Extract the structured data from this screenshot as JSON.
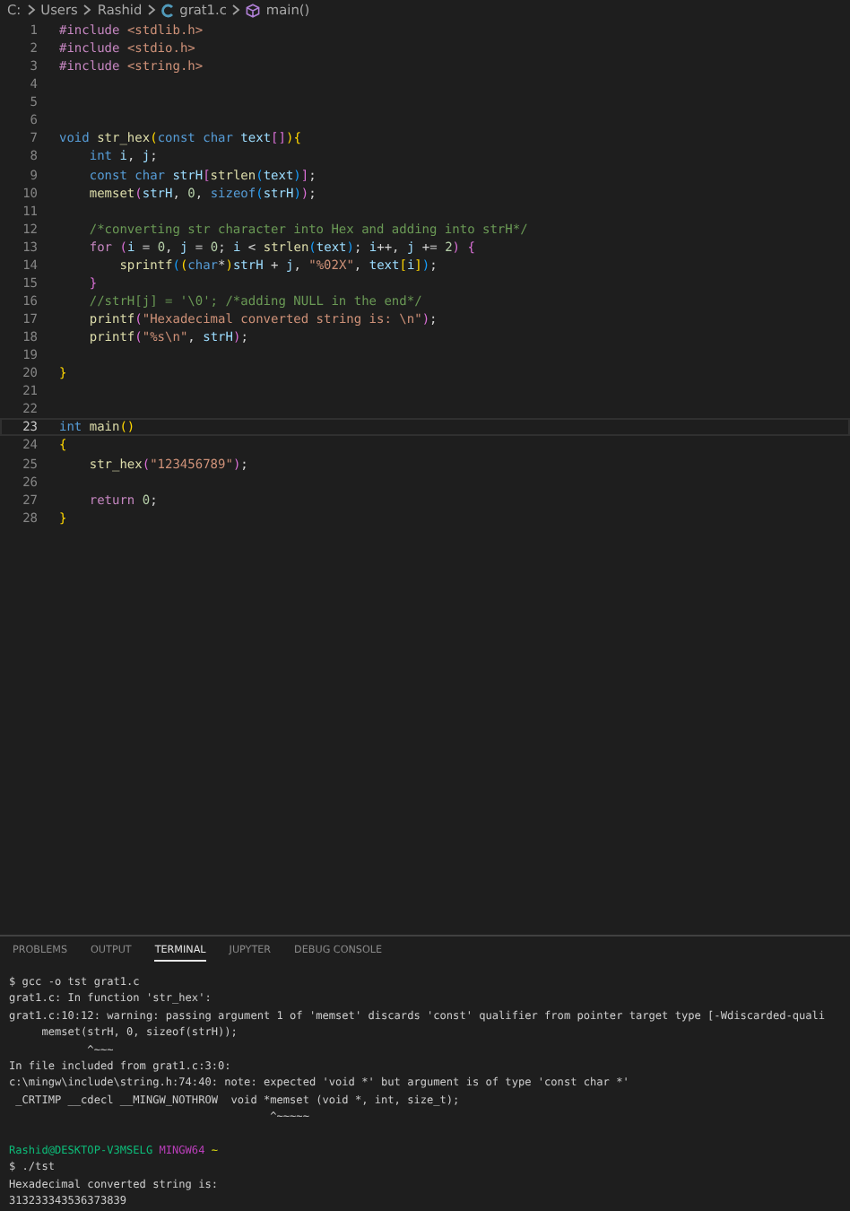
{
  "breadcrumb": [
    {
      "kind": "folder",
      "label": "C:"
    },
    {
      "kind": "folder",
      "label": "Users"
    },
    {
      "kind": "folder",
      "label": "Rashid"
    },
    {
      "kind": "file",
      "label": "grat1.c"
    },
    {
      "kind": "symbol",
      "label": "main()"
    }
  ],
  "editor": {
    "lines": [
      {
        "number": "1",
        "current": false,
        "tokens": [
          {
            "kind": "pp",
            "text": "#include "
          },
          {
            "kind": "str",
            "text": "<stdlib.h>"
          }
        ]
      },
      {
        "number": "2",
        "current": false,
        "tokens": [
          {
            "kind": "pp",
            "text": "#include "
          },
          {
            "kind": "str",
            "text": "<stdio.h>"
          }
        ]
      },
      {
        "number": "3",
        "current": false,
        "tokens": [
          {
            "kind": "pp",
            "text": "#include "
          },
          {
            "kind": "str",
            "text": "<string.h>"
          }
        ]
      },
      {
        "number": "4",
        "current": false
      },
      {
        "number": "5",
        "current": false
      },
      {
        "number": "6",
        "current": false
      },
      {
        "number": "7",
        "current": false,
        "tokens": [
          {
            "kind": "kw",
            "text": "void "
          },
          {
            "kind": "fn",
            "text": "str_hex"
          },
          {
            "kind": "b1",
            "text": "("
          },
          {
            "kind": "kw",
            "text": "const char "
          },
          {
            "kind": "var",
            "text": "text"
          },
          {
            "kind": "b2",
            "text": "[]"
          },
          {
            "kind": "b1",
            "text": ")"
          },
          {
            "kind": "b1",
            "text": "{"
          }
        ]
      },
      {
        "number": "8",
        "current": false,
        "tokens": [
          {
            "kind": "kw",
            "text": "    int "
          },
          {
            "kind": "var",
            "text": "i"
          },
          {
            "kind": "plain",
            "text": ", "
          },
          {
            "kind": "var",
            "text": "j"
          },
          {
            "kind": "plain",
            "text": ";"
          }
        ]
      },
      {
        "number": "9",
        "current": false,
        "tokens": [
          {
            "kind": "kw",
            "text": "    const char "
          },
          {
            "kind": "var",
            "text": "strH"
          },
          {
            "kind": "b2",
            "text": "["
          },
          {
            "kind": "fn",
            "text": "strlen"
          },
          {
            "kind": "b3",
            "text": "("
          },
          {
            "kind": "var",
            "text": "text"
          },
          {
            "kind": "b3",
            "text": ")"
          },
          {
            "kind": "b2",
            "text": "]"
          },
          {
            "kind": "plain",
            "text": ";"
          }
        ]
      },
      {
        "number": "10",
        "current": false,
        "tokens": [
          {
            "kind": "fn",
            "text": "    memset"
          },
          {
            "kind": "b2",
            "text": "("
          },
          {
            "kind": "var",
            "text": "strH"
          },
          {
            "kind": "plain",
            "text": ", "
          },
          {
            "kind": "num",
            "text": "0"
          },
          {
            "kind": "plain",
            "text": ", "
          },
          {
            "kind": "kw",
            "text": "sizeof"
          },
          {
            "kind": "b3",
            "text": "("
          },
          {
            "kind": "var",
            "text": "strH"
          },
          {
            "kind": "b3",
            "text": ")"
          },
          {
            "kind": "b2",
            "text": ")"
          },
          {
            "kind": "plain",
            "text": ";"
          }
        ]
      },
      {
        "number": "11",
        "current": false
      },
      {
        "number": "12",
        "current": false,
        "tokens": [
          {
            "kind": "comment",
            "text": "    /*converting str character into Hex and adding into strH*/"
          }
        ]
      },
      {
        "number": "13",
        "current": false,
        "tokens": [
          {
            "kind": "ctl",
            "text": "    for "
          },
          {
            "kind": "b2",
            "text": "("
          },
          {
            "kind": "var",
            "text": "i"
          },
          {
            "kind": "plain",
            "text": " = "
          },
          {
            "kind": "num",
            "text": "0"
          },
          {
            "kind": "plain",
            "text": ", "
          },
          {
            "kind": "var",
            "text": "j"
          },
          {
            "kind": "plain",
            "text": " = "
          },
          {
            "kind": "num",
            "text": "0"
          },
          {
            "kind": "plain",
            "text": "; "
          },
          {
            "kind": "var",
            "text": "i"
          },
          {
            "kind": "plain",
            "text": " < "
          },
          {
            "kind": "fn",
            "text": "strlen"
          },
          {
            "kind": "b3",
            "text": "("
          },
          {
            "kind": "var",
            "text": "text"
          },
          {
            "kind": "b3",
            "text": ")"
          },
          {
            "kind": "plain",
            "text": "; "
          },
          {
            "kind": "var",
            "text": "i"
          },
          {
            "kind": "plain",
            "text": "++, "
          },
          {
            "kind": "var",
            "text": "j"
          },
          {
            "kind": "plain",
            "text": " += "
          },
          {
            "kind": "num",
            "text": "2"
          },
          {
            "kind": "b2",
            "text": ") {"
          }
        ]
      },
      {
        "number": "14",
        "current": false,
        "tokens": [
          {
            "kind": "fn",
            "text": "        sprintf"
          },
          {
            "kind": "b3",
            "text": "("
          },
          {
            "kind": "b1",
            "text": "("
          },
          {
            "kind": "kw",
            "text": "char"
          },
          {
            "kind": "plain",
            "text": "*"
          },
          {
            "kind": "b1",
            "text": ")"
          },
          {
            "kind": "var",
            "text": "strH"
          },
          {
            "kind": "plain",
            "text": " + "
          },
          {
            "kind": "var",
            "text": "j"
          },
          {
            "kind": "plain",
            "text": ", "
          },
          {
            "kind": "str",
            "text": "\"%02X\""
          },
          {
            "kind": "plain",
            "text": ", "
          },
          {
            "kind": "var",
            "text": "text"
          },
          {
            "kind": "b1",
            "text": "["
          },
          {
            "kind": "var",
            "text": "i"
          },
          {
            "kind": "b1",
            "text": "]"
          },
          {
            "kind": "b3",
            "text": ")"
          },
          {
            "kind": "plain",
            "text": ";"
          }
        ]
      },
      {
        "number": "15",
        "current": false,
        "tokens": [
          {
            "kind": "b2",
            "text": "    }"
          }
        ]
      },
      {
        "number": "16",
        "current": false,
        "tokens": [
          {
            "kind": "comment",
            "text": "    //strH[j] = '\\0'; /*adding NULL in the end*/"
          }
        ]
      },
      {
        "number": "17",
        "current": false,
        "tokens": [
          {
            "kind": "fn",
            "text": "    printf"
          },
          {
            "kind": "b2",
            "text": "("
          },
          {
            "kind": "str",
            "text": "\"Hexadecimal converted string is: \\n\""
          },
          {
            "kind": "b2",
            "text": ")"
          },
          {
            "kind": "plain",
            "text": ";"
          }
        ]
      },
      {
        "number": "18",
        "current": false,
        "tokens": [
          {
            "kind": "fn",
            "text": "    printf"
          },
          {
            "kind": "b2",
            "text": "("
          },
          {
            "kind": "str",
            "text": "\"%s\\n\""
          },
          {
            "kind": "plain",
            "text": ", "
          },
          {
            "kind": "var",
            "text": "strH"
          },
          {
            "kind": "b2",
            "text": ")"
          },
          {
            "kind": "plain",
            "text": ";"
          }
        ]
      },
      {
        "number": "19",
        "current": false
      },
      {
        "number": "20",
        "current": false,
        "tokens": [
          {
            "kind": "b1",
            "text": "}"
          }
        ]
      },
      {
        "number": "21",
        "current": false
      },
      {
        "number": "22",
        "current": false
      },
      {
        "number": "23",
        "current": true,
        "tokens": [
          {
            "kind": "kw",
            "text": "int "
          },
          {
            "kind": "fn",
            "text": "main"
          },
          {
            "kind": "b1",
            "text": "()"
          }
        ]
      },
      {
        "number": "24",
        "current": false,
        "tokens": [
          {
            "kind": "b1",
            "text": "{"
          }
        ]
      },
      {
        "number": "25",
        "current": false,
        "tokens": [
          {
            "kind": "fn",
            "text": "    str_hex"
          },
          {
            "kind": "b2",
            "text": "("
          },
          {
            "kind": "str",
            "text": "\"123456789\""
          },
          {
            "kind": "b2",
            "text": ")"
          },
          {
            "kind": "plain",
            "text": ";"
          }
        ]
      },
      {
        "number": "26",
        "current": false
      },
      {
        "number": "27",
        "current": false,
        "tokens": [
          {
            "kind": "ctl",
            "text": "    return "
          },
          {
            "kind": "num",
            "text": "0"
          },
          {
            "kind": "plain",
            "text": ";"
          }
        ]
      },
      {
        "number": "28",
        "current": false,
        "tokens": [
          {
            "kind": "b1",
            "text": "}"
          }
        ]
      }
    ]
  },
  "panel": {
    "tabs": [
      {
        "label": "PROBLEMS",
        "selected": false
      },
      {
        "label": "OUTPUT",
        "selected": false
      },
      {
        "label": "TERMINAL",
        "selected": true
      },
      {
        "label": "JUPYTER",
        "selected": false
      },
      {
        "label": "DEBUG CONSOLE",
        "selected": false
      }
    ],
    "terminal": [
      {
        "segments": [
          {
            "kind": "plain",
            "text": "$ gcc -o tst grat1.c"
          }
        ]
      },
      {
        "segments": [
          {
            "kind": "plain",
            "text": "grat1.c: In function 'str_hex':"
          }
        ]
      },
      {
        "segments": [
          {
            "kind": "plain",
            "text": "grat1.c:10:12: warning: passing argument 1 of 'memset' discards 'const' qualifier from pointer target type [-Wdiscarded-quali"
          }
        ]
      },
      {
        "segments": [
          {
            "kind": "plain",
            "text": "     memset(strH, 0, sizeof(strH));"
          }
        ]
      },
      {
        "segments": [
          {
            "kind": "plain",
            "text": "            ^~~~"
          }
        ]
      },
      {
        "segments": [
          {
            "kind": "plain",
            "text": "In file included from grat1.c:3:0:"
          }
        ]
      },
      {
        "segments": [
          {
            "kind": "plain",
            "text": "c:\\mingw\\include\\string.h:74:40: note: expected 'void *' but argument is of type 'const char *'"
          }
        ]
      },
      {
        "segments": [
          {
            "kind": "plain",
            "text": " _CRTIMP __cdecl __MINGW_NOTHROW  void *memset (void *, int, size_t);"
          }
        ]
      },
      {
        "segments": [
          {
            "kind": "plain",
            "text": "                                        ^~~~~~"
          }
        ]
      },
      {
        "kind": "blank"
      },
      {
        "segments": [
          {
            "kind": "user",
            "text": "Rashid@DESKTOP-V3MSELG "
          },
          {
            "kind": "env",
            "text": "MINGW64 "
          },
          {
            "kind": "path",
            "text": "~"
          }
        ]
      },
      {
        "segments": [
          {
            "kind": "plain",
            "text": "$ ./tst"
          }
        ]
      },
      {
        "segments": [
          {
            "kind": "plain",
            "text": "Hexadecimal converted string is:"
          }
        ]
      },
      {
        "segments": [
          {
            "kind": "plain",
            "text": "313233343536373839"
          }
        ]
      }
    ]
  }
}
